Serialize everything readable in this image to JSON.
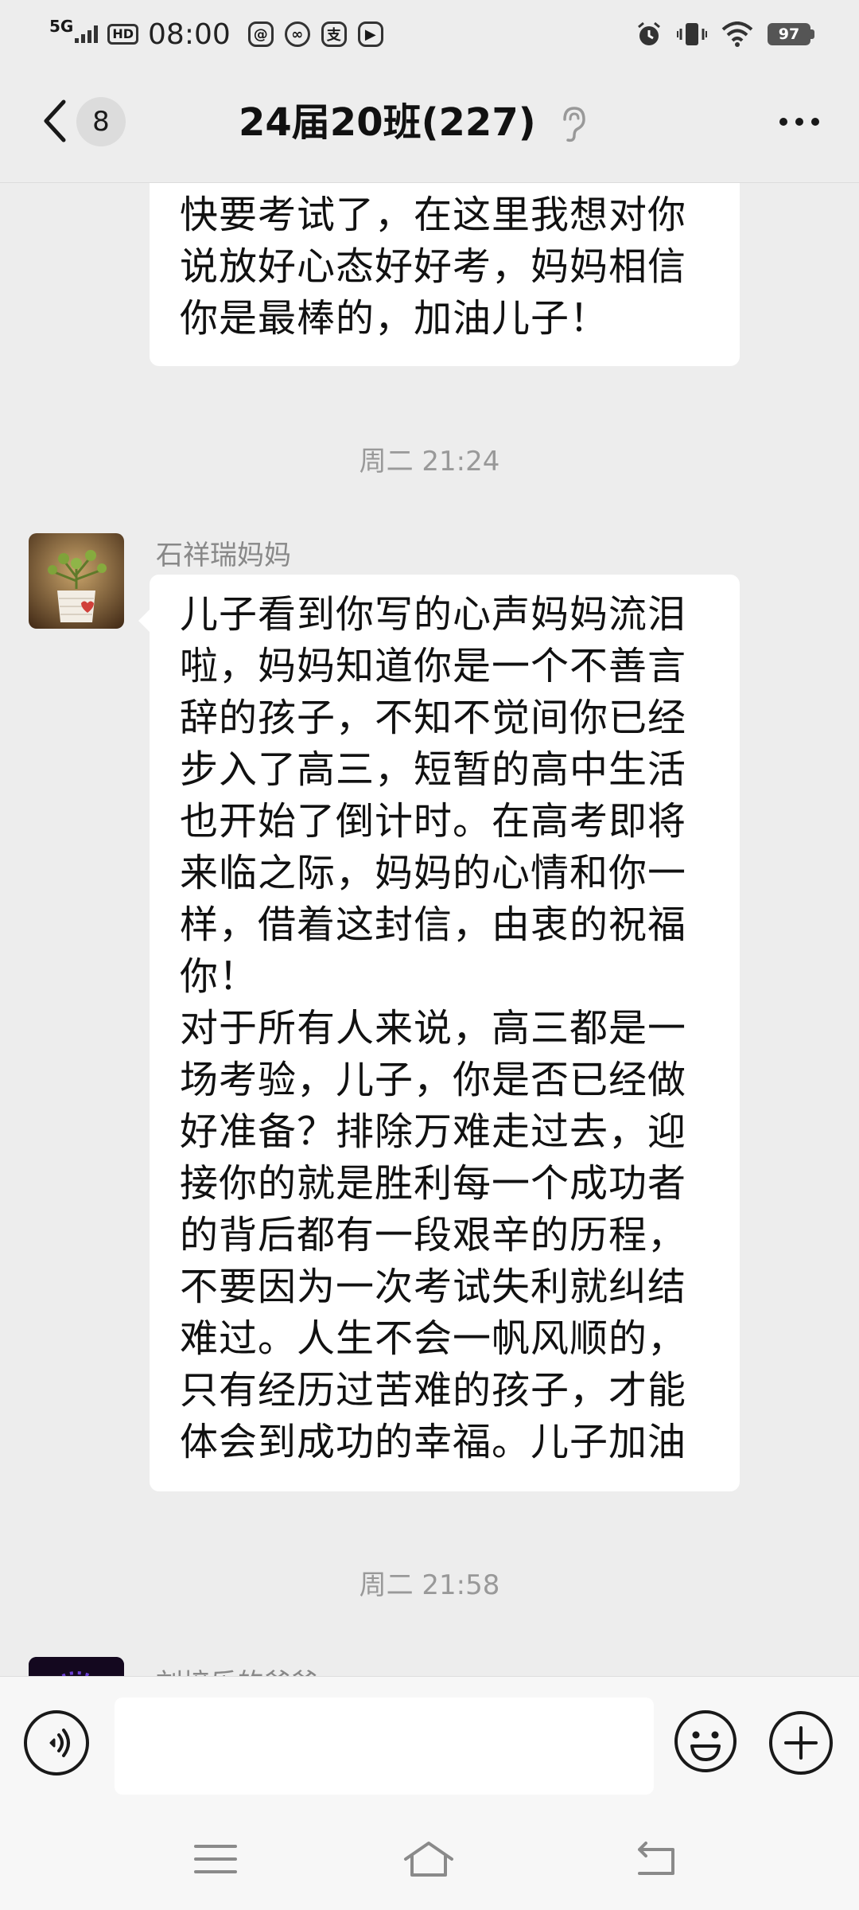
{
  "status_bar": {
    "network": "5G",
    "hd": "HD",
    "time": "08:00",
    "notif_icons": [
      "message-icon",
      "link-icon",
      "alipay-icon",
      "video-icon"
    ],
    "alipay_char": "支",
    "battery": "97"
  },
  "header": {
    "unread_count": "8",
    "title": "24届20班(227)"
  },
  "messages": {
    "prev_text": "快要考试了，在这里我想对你\n说放好心态好好考，妈妈相信\n你是最棒的，加油儿子！",
    "timestamp_1": "周二  21:24",
    "sender_1": "石祥瑞妈妈",
    "main_text": "儿子看到你写的心声妈妈流泪\n啦，妈妈知道你是一个不善言\n辞的孩子，不知不觉间你已经\n步入了高三，短暂的高中生活\n也开始了倒计时。在高考即将\n来临之际，妈妈的心情和你一\n样，借着这封信，由衷的祝福\n你！\n对于所有人来说，高三都是一\n场考验，儿子，你是否已经做\n好准备？排除万难走过去，迎\n接你的就是胜利每一个成功者\n的背后都有一段艰辛的历程，\n不要因为一次考试失利就纠结\n难过。人生不会一帆风顺的，\n只有经历过苦难的孩子，才能\n体会到成功的幸福。儿子加油",
    "timestamp_2": "周二  21:58",
    "sender_2": "刘培乐的爸爸"
  },
  "input": {
    "placeholder": ""
  },
  "colors": {
    "background": "#ededed",
    "bubble": "#ffffff",
    "timestamp": "#999999"
  }
}
